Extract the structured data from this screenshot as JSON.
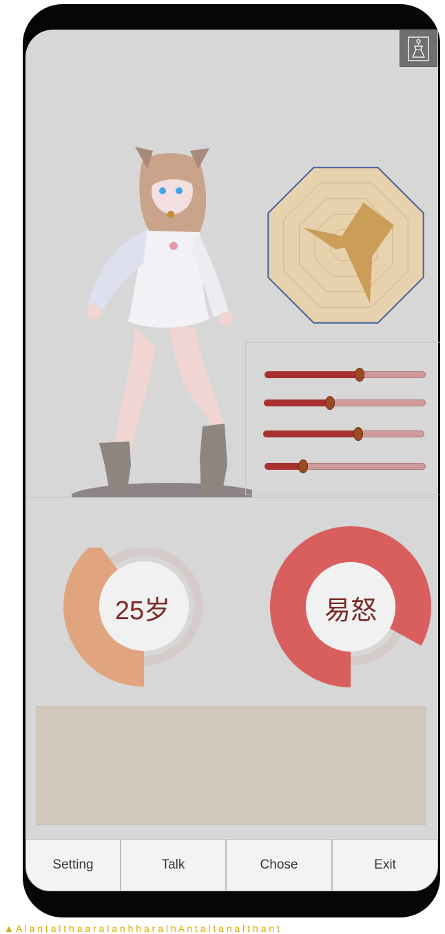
{
  "icons": {
    "wardrobe": "dress-hanger-icon",
    "warning": "warning-icon"
  },
  "character": {
    "hair_color": "#c9a38a",
    "sweater_color": "#f2f2f6",
    "boot_color": "#8d8580"
  },
  "radar_chart": {
    "axes": 8,
    "rings": 5,
    "values": [
      0.12,
      0.55,
      0.62,
      0.34,
      0.75,
      0.03,
      0.13,
      0.55
    ],
    "fill_color": "#c69549",
    "bg_color": "#e8d2ad",
    "outline_color": "#46609a"
  },
  "sliders": [
    {
      "value": 0.59
    },
    {
      "value": 0.41
    },
    {
      "value": 0.59
    },
    {
      "value": 0.24
    }
  ],
  "age_gauge": {
    "label": "25岁",
    "value": 0.4,
    "color": "#e0a57e"
  },
  "mood_gauge": {
    "label": "易怒",
    "value": 0.83,
    "color": "#d95f5f"
  },
  "message_box": {
    "text": ""
  },
  "nav": {
    "setting": "Setting",
    "talk": "Talk",
    "chose": "Chose",
    "exit": "Exit"
  },
  "warning": {
    "text": "A l a n t a l t h a a r a l a n h h a r a l h A n t a l t a n a l t h a n t"
  }
}
